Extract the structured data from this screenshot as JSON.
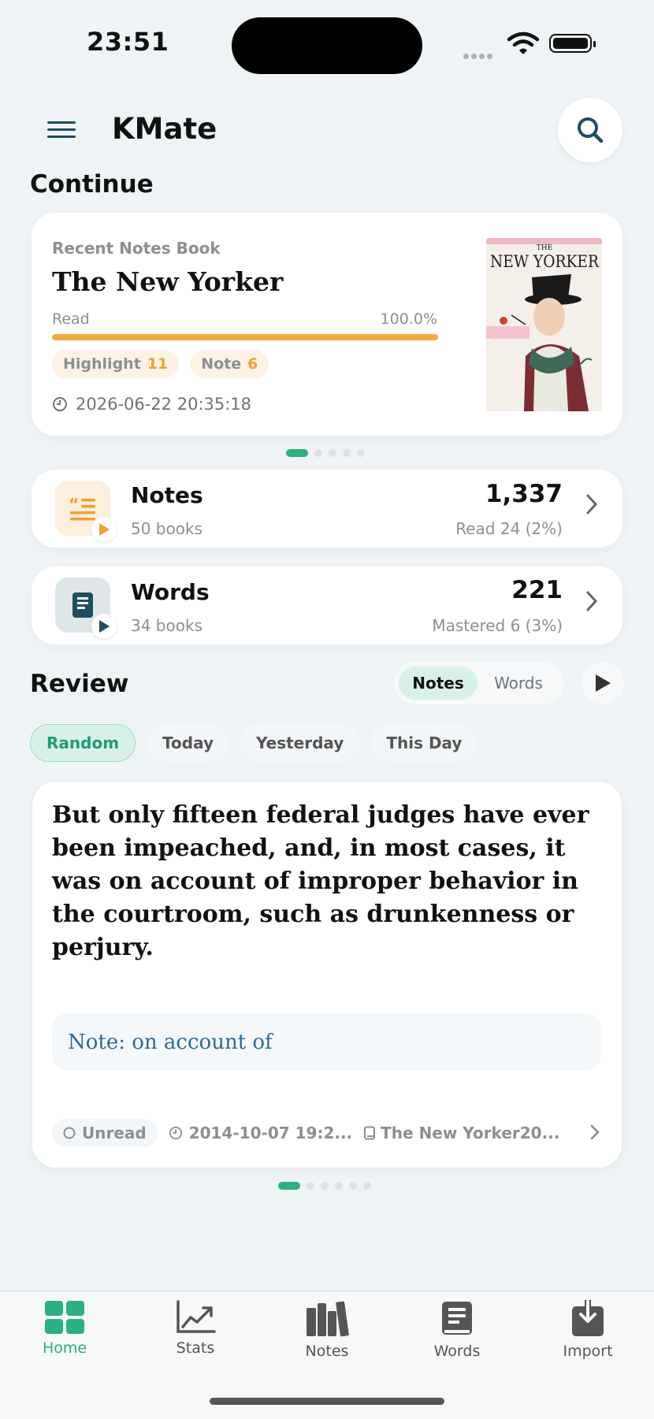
{
  "status": {
    "time": "23:51"
  },
  "header": {
    "title": "KMate"
  },
  "continue": {
    "section_title": "Continue",
    "card": {
      "label": "Recent Notes Book",
      "book_title": "The New Yorker",
      "read_label": "Read",
      "read_percent": "100.0%",
      "progress": 1.0,
      "highlight_label": "Highlight",
      "highlight_count": "11",
      "note_label": "Note",
      "note_count": "6",
      "timestamp": "2026-06-22 20:35:18",
      "cover": {
        "top_text": "THE",
        "masthead": "NEW YORKER"
      }
    },
    "pager": {
      "count": 5,
      "active": 0
    }
  },
  "stats": {
    "notes": {
      "title": "Notes",
      "subtitle": "50 books",
      "count": "1,337",
      "detail": "Read 24 (2%)"
    },
    "words": {
      "title": "Words",
      "subtitle": "34 books",
      "count": "221",
      "detail": "Mastered 6 (3%)"
    }
  },
  "review": {
    "section_title": "Review",
    "segments": [
      "Notes",
      "Words"
    ],
    "active_segment": "Notes",
    "filters": [
      "Random",
      "Today",
      "Yesterday",
      "This Day"
    ],
    "active_filter": "Random",
    "card": {
      "quote": "But only fifteen federal judges have ever been impeached, and, in most cases, it was on account of improper behavior in the courtroom, such as drunkenness or perjury.",
      "note": "Note: on account of",
      "status": "Unread",
      "date": "2014-10-07 19:2...",
      "book": "The New Yorker20..."
    },
    "pager": {
      "count": 6,
      "active": 0
    }
  },
  "tabs": [
    {
      "label": "Home",
      "icon": "home-grid-icon",
      "active": true
    },
    {
      "label": "Stats",
      "icon": "chart-icon",
      "active": false
    },
    {
      "label": "Notes",
      "icon": "books-icon",
      "active": false
    },
    {
      "label": "Words",
      "icon": "book-icon",
      "active": false
    },
    {
      "label": "Import",
      "icon": "import-icon",
      "active": false
    }
  ],
  "colors": {
    "accent": "#2bb07f",
    "progress": "#f1ac40",
    "note_text": "#2d6a96"
  }
}
